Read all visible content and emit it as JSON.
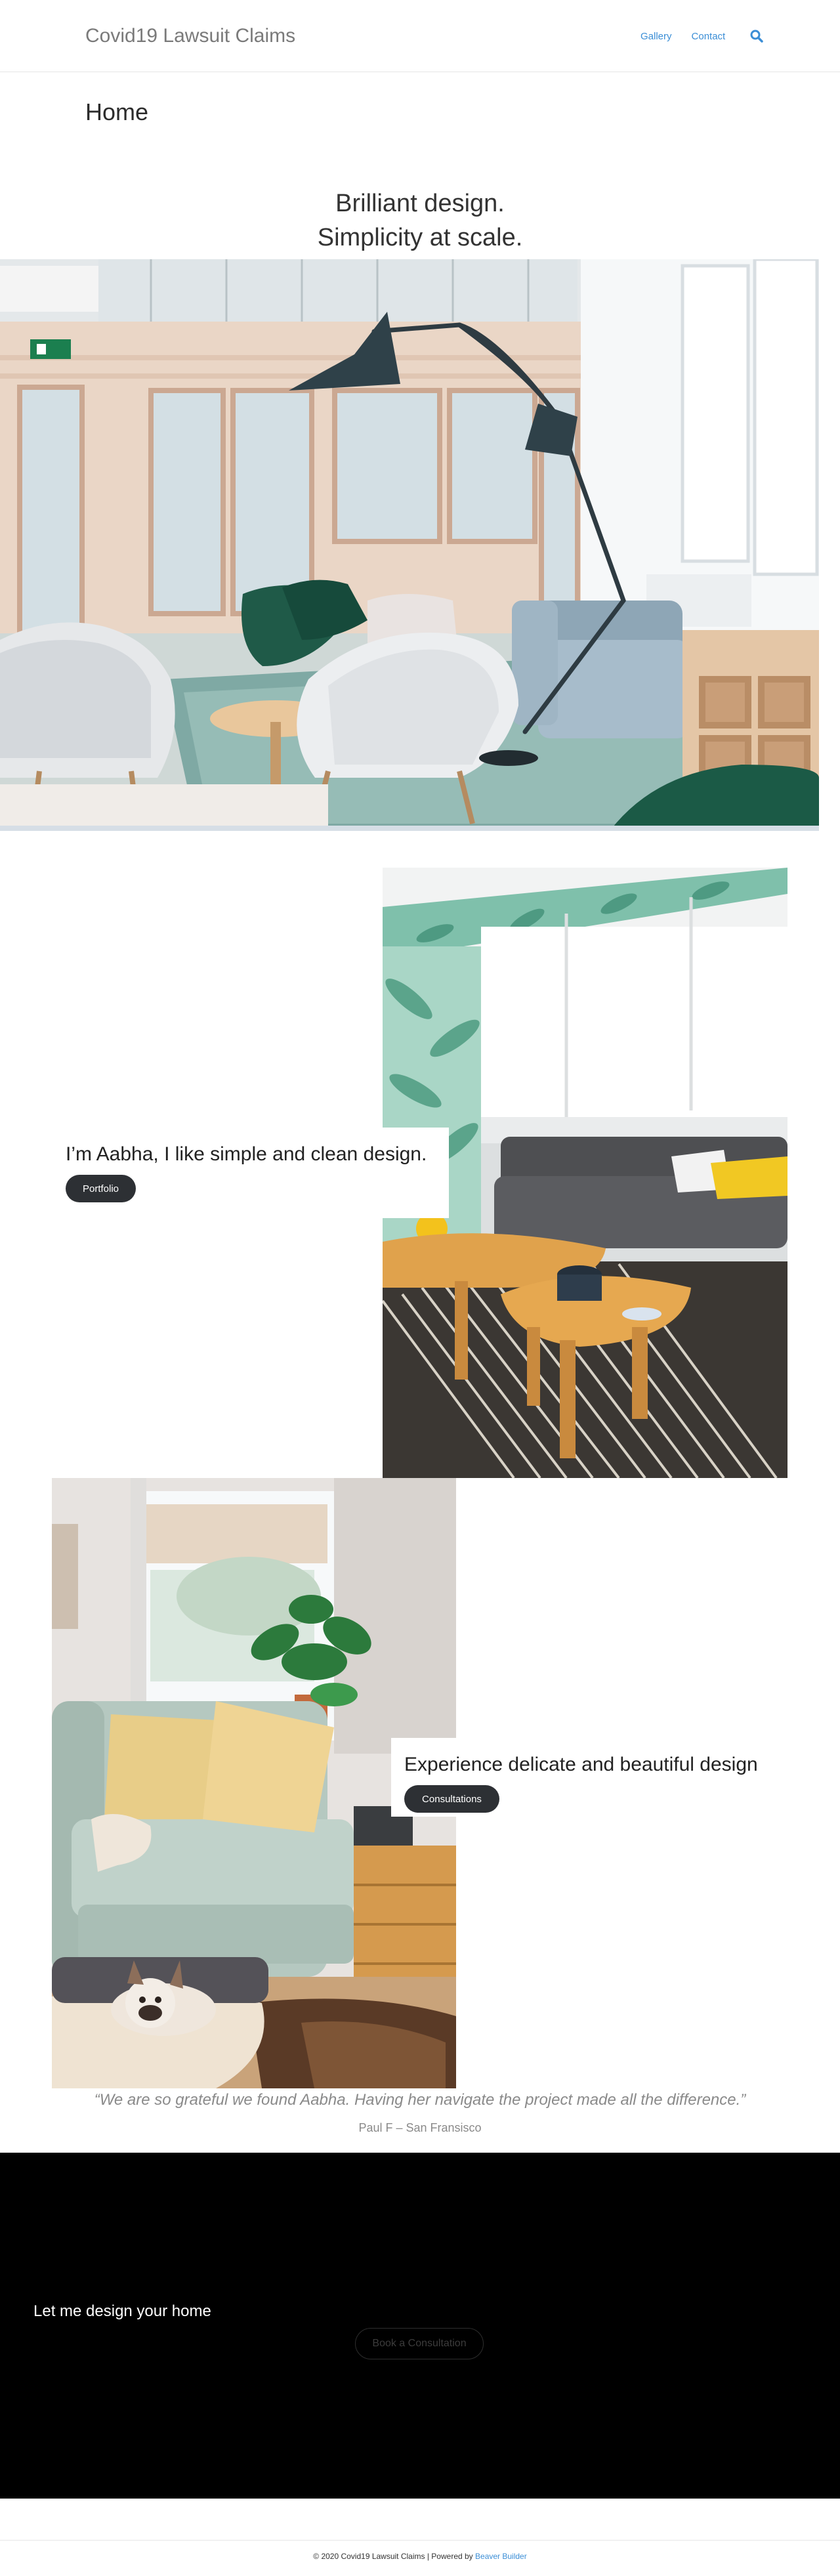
{
  "header": {
    "site_title": "Covid19 Lawsuit Claims",
    "nav": [
      {
        "label": "Gallery"
      },
      {
        "label": "Contact"
      }
    ]
  },
  "page": {
    "title": "Home"
  },
  "hero": {
    "line1": "Brilliant design.",
    "line2": "Simplicity at scale."
  },
  "about": {
    "text": "I’m Aabha, I like simple and clean design.",
    "button": "Portfolio"
  },
  "consult": {
    "text": "Experience delicate and beautiful design",
    "button": "Consultations"
  },
  "testimonial": {
    "quote": "“We are so grateful we found Aabha. Having her navigate the project made all the difference.”",
    "author": "Paul F – San Fransisco"
  },
  "cta": {
    "text": "Let me design your home",
    "button": "Book a Consultation"
  },
  "footer": {
    "text": "© 2020 Covid19 Lawsuit Claims | Powered by ",
    "link": "Beaver Builder"
  },
  "colors": {
    "link": "#3b8ed6",
    "button": "#2d3034",
    "cta_bg": "#000000"
  },
  "icons": {
    "search": "search-icon"
  }
}
